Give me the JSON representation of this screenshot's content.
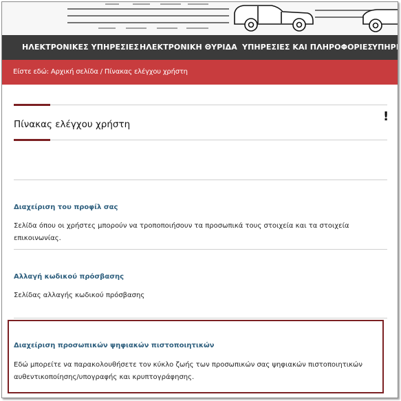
{
  "nav": {
    "items": [
      {
        "label": "ΗΛΕΚΤΡΟΝΙΚΕΣ ΥΠΗΡΕΣΙΕΣ"
      },
      {
        "label": "ΗΛΕΚΤΡΟΝΙΚΗ ΘΥΡΙΔΑ"
      },
      {
        "label": "ΥΠΗΡΕΣΙΕΣ ΚΑΙ ΠΛΗΡΟΦΟΡΙΕΣ"
      },
      {
        "label": "ΥΠΗΡΕ"
      }
    ]
  },
  "breadcrumb": {
    "text": "Είστε εδώ: Αρχική σελίδα / Πίνακας ελέγχου χρήστη"
  },
  "page": {
    "title": "Πίνακας ελέγχου χρήστη",
    "alert_symbol": "!"
  },
  "sections": [
    {
      "title": "Διαχείριση του προφίλ σας",
      "description": "Σελίδα όπου οι χρήστες μπορούν να τροποποιήσουν τα προσωπικά τους στοιχεία και τα στοιχεία επικοινωνίας."
    },
    {
      "title": "Αλλαγή κωδικού πρόσβασης",
      "description": "Σελίδας αλλαγής κωδικού πρόσβασης"
    },
    {
      "title": "Διαχείριση προσωπικών ψηφιακών πιστοποιητικών",
      "description": "Εδώ μπορείτε να παρακολουθήσετε τον κύκλο ζωής των προσωπικών σας ψηφιακών πιστοποιητικών αυθεντικοποίησης/υπογραφής και κρυπτογράφησης."
    }
  ],
  "colors": {
    "nav_bg": "#3b3b3b",
    "breadcrumb_bg": "#c83c3e",
    "accent": "#7b1f22",
    "link": "#2d5e7d"
  }
}
